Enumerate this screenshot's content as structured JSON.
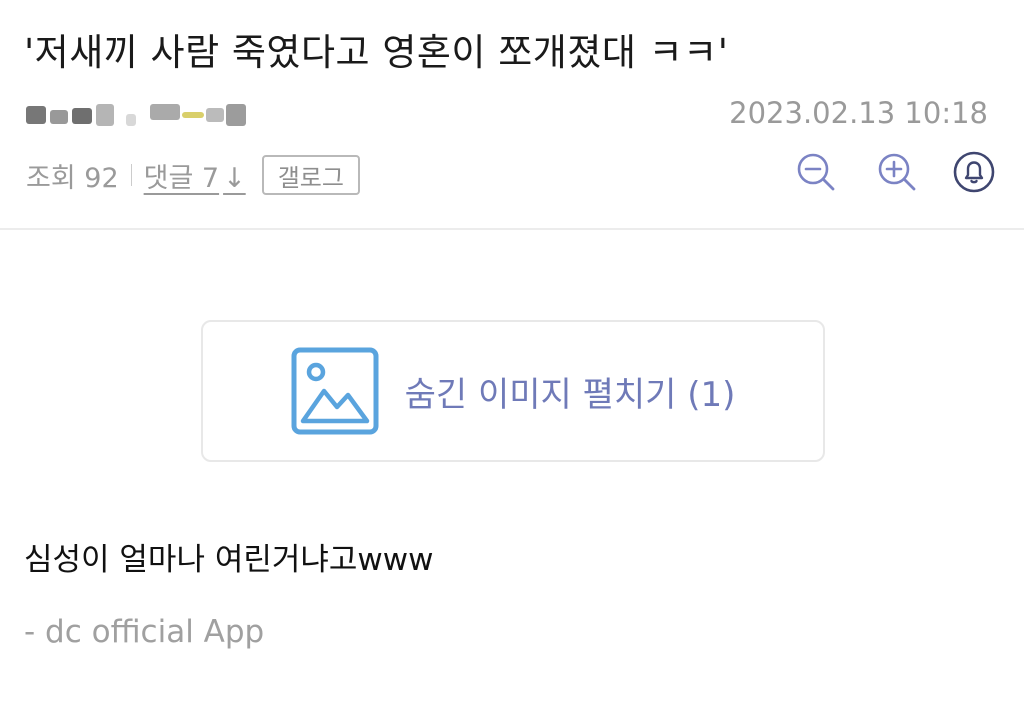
{
  "post": {
    "title": "'저새끼 사람 죽였다고 영혼이 쪼개졌대 ㅋㅋ'",
    "date": "2023.02.13 10:18",
    "views_label": "조회 92",
    "comments_label": "댓글 7",
    "comments_arrow": "↓",
    "gallog_label": "갤로그"
  },
  "hidden_images": {
    "label": "숨긴 이미지 펼치기 (1)"
  },
  "content": {
    "body": "심성이 얼마나 여린거냐고www",
    "signature": "- dc official App"
  },
  "icons": {
    "zoom_out": "zoom-out-icon",
    "zoom_in": "zoom-in-icon",
    "notification": "bell-icon",
    "image": "image-icon"
  },
  "colors": {
    "accent": "#6f7ab8",
    "image_icon": "#5aa4de",
    "muted_text": "#9a9a9a"
  }
}
